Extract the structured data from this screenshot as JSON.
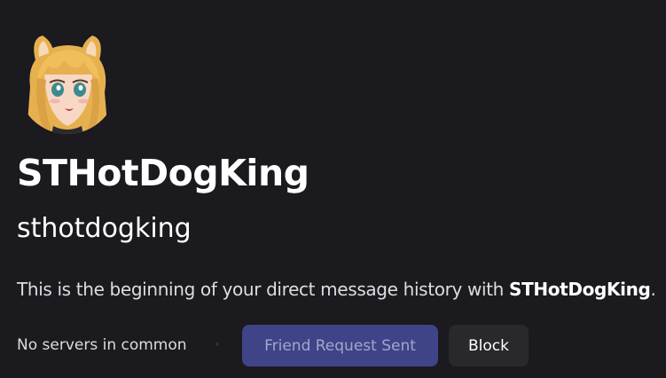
{
  "profile": {
    "display_name": "STHotDogKing",
    "username": "sthotdogking",
    "avatar_icon": "anime-girl-avatar"
  },
  "intro": {
    "prefix": "This is the beginning of your direct message history with ",
    "name": "STHotDogKing",
    "suffix": "."
  },
  "mutual": {
    "servers_text": "No servers in common"
  },
  "actions": {
    "friend_request_label": "Friend Request Sent",
    "block_label": "Block"
  },
  "colors": {
    "background": "#1a1a1f",
    "friend_button": "#3f4489",
    "block_button": "#28282d"
  }
}
